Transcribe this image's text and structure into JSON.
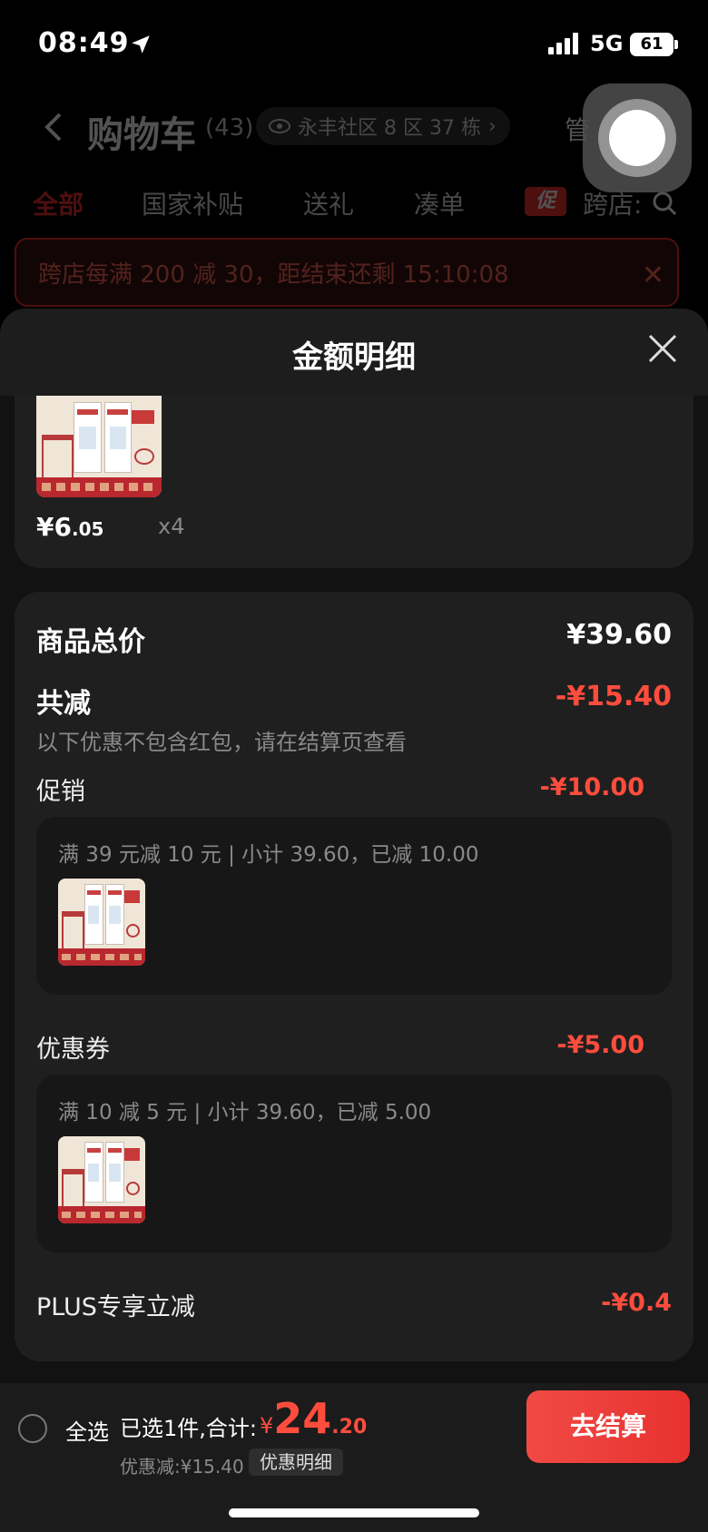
{
  "status_bar": {
    "time": "08:49",
    "network": "5G",
    "battery": "61"
  },
  "background_page": {
    "title": "购物车",
    "count": "(43)",
    "address": "永丰社区 8 区 37 栋",
    "manage": "管",
    "tabs": [
      "全部",
      "国家补贴",
      "送礼",
      "凑单",
      "跨店:"
    ],
    "promo_tag": "促",
    "banner": "跨店每满 200 减 30，距结束还剩 15:10:08"
  },
  "sheet": {
    "title": "金额明细",
    "item": {
      "price_main": "¥6",
      "price_decimal": ".05",
      "quantity": "x4"
    },
    "summary": {
      "total_label": "商品总价",
      "total_value": "¥39.60",
      "reduce_label": "共减",
      "reduce_value": "-¥15.40",
      "reduce_note": "以下优惠不包含红包，请在结算页查看"
    },
    "promotion": {
      "label": "促销",
      "value": "-¥10.00",
      "detail": "满 39 元减 10 元 | 小计 39.60，已减 10.00"
    },
    "coupon": {
      "label": "优惠券",
      "value": "-¥5.00",
      "detail": "满 10 减 5 元 | 小计 39.60，已减 5.00"
    },
    "plus": {
      "label": "PLUS专享立减",
      "value": "-¥0.4"
    }
  },
  "bottom_bar": {
    "select_all": "全选",
    "selected_text": "已选1件,合计:",
    "currency": "¥",
    "amount_main": "24",
    "amount_decimal": ".20",
    "saved": "优惠减:¥15.40",
    "detail_button": "优惠明细",
    "checkout_button": "去结算"
  },
  "colors": {
    "accent": "#ff4d3d",
    "checkout": "#e8322f",
    "sheet_bg": "#121212",
    "card_bg": "#1f1f1f"
  }
}
